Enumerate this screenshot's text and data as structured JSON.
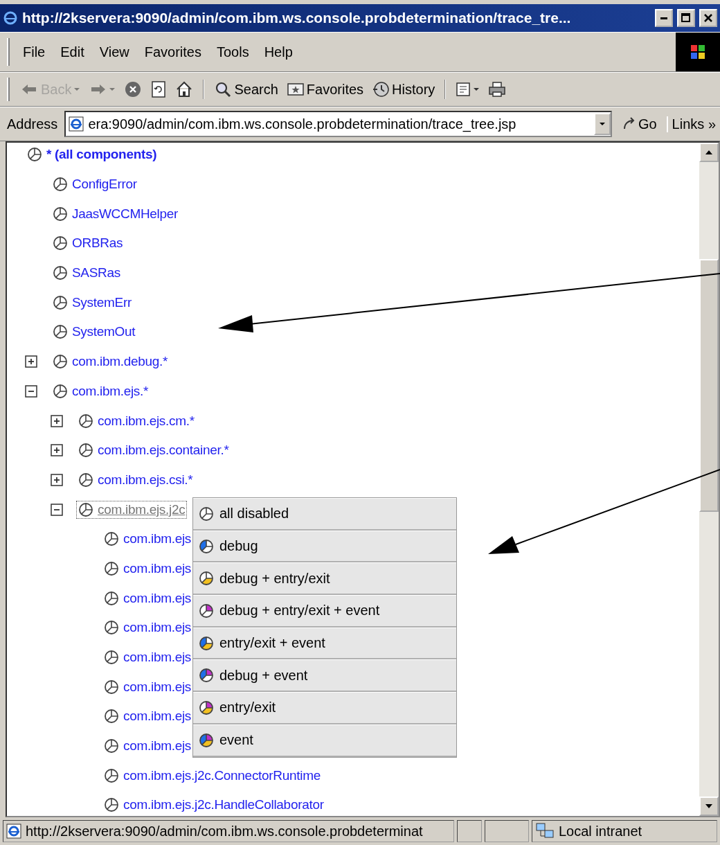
{
  "window": {
    "title": "http://2kservera:9090/admin/com.ibm.ws.console.probdetermination/trace_tre..."
  },
  "menu_bar": [
    "File",
    "Edit",
    "View",
    "Favorites",
    "Tools",
    "Help"
  ],
  "toolbar": [
    {
      "kind": "back",
      "label": "Back",
      "disabled": true
    },
    {
      "kind": "forward",
      "disabled": true
    },
    {
      "kind": "stop",
      "disabled": false
    },
    {
      "kind": "refresh",
      "disabled": false
    },
    {
      "kind": "home",
      "disabled": false
    },
    {
      "kind": "search",
      "label": "Search",
      "disabled": false
    },
    {
      "kind": "favorites",
      "label": "Favorites",
      "disabled": false
    },
    {
      "kind": "history",
      "label": "History",
      "disabled": false
    },
    {
      "kind": "mail",
      "disabled": false
    },
    {
      "kind": "print",
      "disabled": false
    }
  ],
  "address_bar": {
    "label": "Address",
    "value": "era:9090/admin/com.ibm.ws.console.probdetermination/trace_tree.jsp",
    "go": "Go",
    "links": "Links",
    "more": "»"
  },
  "tree": [
    {
      "label": "* (all components)",
      "selected": false,
      "children": [
        {
          "label": "ConfigError",
          "selected": false
        },
        {
          "label": "JaasWCCMHelper",
          "selected": false
        },
        {
          "label": "ORBRas",
          "selected": false
        },
        {
          "label": "SASRas",
          "selected": false
        },
        {
          "label": "SystemErr",
          "selected": false
        },
        {
          "label": "SystemOut",
          "selected": false
        },
        {
          "label": "com.ibm.debug.*",
          "selected": false,
          "expanded": false
        },
        {
          "label": "com.ibm.ejs.*",
          "selected": false,
          "expanded": true,
          "children": [
            {
              "label": "com.ibm.ejs.cm.*",
              "selected": false,
              "expanded": false
            },
            {
              "label": "com.ibm.ejs.container.*",
              "selected": false,
              "expanded": false
            },
            {
              "label": "com.ibm.ejs.csi.*",
              "selected": false,
              "expanded": false
            },
            {
              "label": "com.ibm.ejs.j2c",
              "selected": true,
              "expanded": true,
              "children": [
                {
                  "label": "com.ibm.ejs",
                  "selected": false
                },
                {
                  "label": "com.ibm.ejs",
                  "selected": false
                },
                {
                  "label": "com.ibm.ejs",
                  "selected": false
                },
                {
                  "label": "com.ibm.ejs",
                  "selected": false
                },
                {
                  "label": "com.ibm.ejs",
                  "selected": false
                },
                {
                  "label": "com.ibm.ejs",
                  "selected": false
                },
                {
                  "label": "com.ibm.ejs",
                  "selected": false
                },
                {
                  "label": "com.ibm.ejs",
                  "selected": false
                },
                {
                  "label": "com.ibm.ejs.j2c.ConnectorRuntime",
                  "selected": false
                },
                {
                  "label": "com.ibm.ejs.j2c.HandleCollaborator",
                  "selected": false
                }
              ]
            }
          ]
        }
      ]
    }
  ],
  "popup_menu": [
    {
      "label": "all disabled"
    },
    {
      "label": "debug",
      "segments": [
        {
          "kind": "left",
          "color": "#1f6fe8"
        }
      ]
    },
    {
      "label": "debug + entry/exit",
      "segments": [
        {
          "kind": "bottom",
          "color": "#f2c020"
        }
      ]
    },
    {
      "label": "debug + entry/exit + event",
      "segments": [
        {
          "kind": "top",
          "color": "#c030c8"
        }
      ]
    },
    {
      "label": "entry/exit + event",
      "segments": [
        {
          "kind": "left",
          "color": "#1f6fe8"
        },
        {
          "kind": "bottom",
          "color": "#f2c020"
        }
      ]
    },
    {
      "label": "debug + event",
      "segments": [
        {
          "kind": "left",
          "color": "#1f6fe8"
        },
        {
          "kind": "top",
          "color": "#c030c8"
        }
      ]
    },
    {
      "label": "entry/exit",
      "segments": [
        {
          "kind": "top",
          "color": "#c030c8"
        },
        {
          "kind": "bottom",
          "color": "#f2c020"
        }
      ]
    },
    {
      "label": "event",
      "segments": [
        {
          "kind": "left",
          "color": "#1f6fe8"
        },
        {
          "kind": "top",
          "color": "#c030c8"
        },
        {
          "kind": "bottom",
          "color": "#f2c020"
        }
      ]
    }
  ],
  "status_bar": {
    "text": "http://2kservera:9090/admin/com.ibm.ws.console.probdeterminat",
    "zone": "Local intranet"
  }
}
